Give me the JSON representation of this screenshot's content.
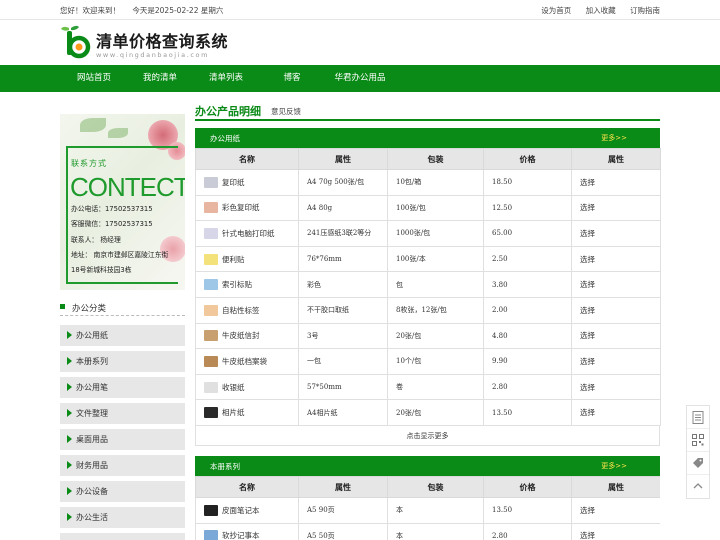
{
  "topbar": {
    "greeting": "您好！欢迎来到！",
    "date_text": "今天是2025-02-22 星期六",
    "links": [
      "设为首页",
      "加入收藏",
      "订购指南"
    ]
  },
  "header": {
    "site_title": "清单价格查询系统",
    "site_domain": "www.qingdanbaojia.com"
  },
  "nav": [
    "网站首页",
    "我的清单",
    "清单列表",
    "博客",
    "华君办公用品"
  ],
  "sidebar": {
    "banner": {
      "label": "联系方式",
      "big_text": "CONTECT",
      "lines": [
        "办公电话：17502537315",
        "客服微信：17502537315",
        "联系人：   杨经理",
        "地址：  南京市建邺区嘉陵江东街",
        "18号新城科技园3栋"
      ]
    },
    "category_heading": "办公分类",
    "categories": [
      "办公用纸",
      "本册系列",
      "办公用笔",
      "文件整理",
      "桌面用品",
      "财务用品",
      "办公设备",
      "办公生活"
    ]
  },
  "main": {
    "title": "办公产品明细",
    "subtitle": "意见反馈",
    "columns": [
      "名称",
      "属性",
      "包装",
      "价格",
      "属性"
    ],
    "sections": [
      {
        "title": "办公用纸",
        "more": "更多>>",
        "rows": [
          {
            "name": "复印纸",
            "attr": "A4 70g 500张/包",
            "pack": "10包/箱",
            "price": "18.50",
            "action": "选择",
            "icon_color": "#c9cbd6"
          },
          {
            "name": "彩色复印纸",
            "attr": "A4 80g",
            "pack": "100张/包",
            "price": "12.50",
            "action": "选择",
            "icon_color": "#e8b6a0"
          },
          {
            "name": "针式电脑打印纸",
            "attr": "241压感纸3联2等分",
            "pack": "1000张/包",
            "price": "65.00",
            "action": "选择",
            "icon_color": "#d6d6e8"
          },
          {
            "name": "便利贴",
            "attr": "76*76mm",
            "pack": "100张/本",
            "price": "2.50",
            "action": "选择",
            "icon_color": "#f3e27a"
          },
          {
            "name": "索引标贴",
            "attr": "彩色",
            "pack": "包",
            "price": "3.80",
            "action": "选择",
            "icon_color": "#9ec6e6"
          },
          {
            "name": "自粘性标签",
            "attr": "不干胶口取纸",
            "pack": "8枚张，12张/包",
            "price": "2.00",
            "action": "选择",
            "icon_color": "#f0c89c"
          },
          {
            "name": "牛皮纸信封",
            "attr": "3号",
            "pack": "20张/包",
            "price": "4.80",
            "action": "选择",
            "icon_color": "#c8a070"
          },
          {
            "name": "牛皮纸档案袋",
            "attr": "一包",
            "pack": "10个/包",
            "price": "9.90",
            "action": "选择",
            "icon_color": "#b98a56"
          },
          {
            "name": "收银纸",
            "attr": "57*50mm",
            "pack": "卷",
            "price": "2.80",
            "action": "选择",
            "icon_color": "#e0e0e0"
          },
          {
            "name": "相片纸",
            "attr": "A4相片纸",
            "pack": "20张/包",
            "price": "13.50",
            "action": "选择",
            "icon_color": "#2a2a2a"
          }
        ],
        "show_more": "点击显示更多"
      },
      {
        "title": "本册系列",
        "more": "更多>>",
        "rows": [
          {
            "name": "皮面笔记本",
            "attr": "A5 90页",
            "pack": "本",
            "price": "13.50",
            "action": "选择",
            "icon_color": "#222222"
          },
          {
            "name": "软抄记事本",
            "attr": "A5 50页",
            "pack": "本",
            "price": "2.80",
            "action": "选择",
            "icon_color": "#7aa9d8"
          }
        ]
      }
    ]
  },
  "colors": {
    "brand_green": "#0a8a16",
    "more_yellow": "#ffe34a"
  },
  "float_tools": [
    "document-icon",
    "qrcode-icon",
    "tag-icon",
    "back-to-top-icon"
  ]
}
